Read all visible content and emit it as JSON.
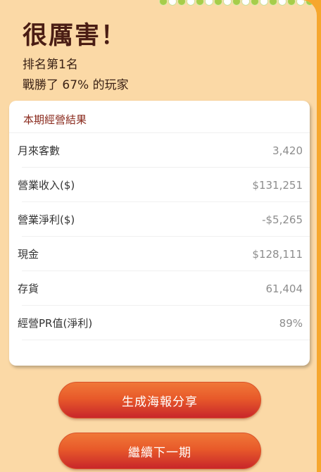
{
  "header": {
    "title": "很厲害！",
    "rank_text": "排名第1名",
    "beat_text": "戰勝了 67% 的玩家"
  },
  "results": {
    "heading": "本期經營結果",
    "rows": [
      {
        "label": "月來客數",
        "value": "3,420"
      },
      {
        "label": "營業收入($)",
        "value": "$131,251"
      },
      {
        "label": "營業淨利($)",
        "value": "-$5,265"
      },
      {
        "label": "現金",
        "value": "$128,111"
      },
      {
        "label": "存貨",
        "value": "61,404"
      },
      {
        "label": "經營PR值(淨利)",
        "value": "89%"
      }
    ]
  },
  "actions": {
    "share_label": "生成海報分享",
    "next_label": "繼續下一期"
  },
  "colors": {
    "panel_bg": "#fbd9a6",
    "outer_bg": "#f6a72e",
    "title": "#4a1d14",
    "heading": "#8a2a1d",
    "button_top": "#f07838",
    "button_bottom": "#c8262a"
  }
}
